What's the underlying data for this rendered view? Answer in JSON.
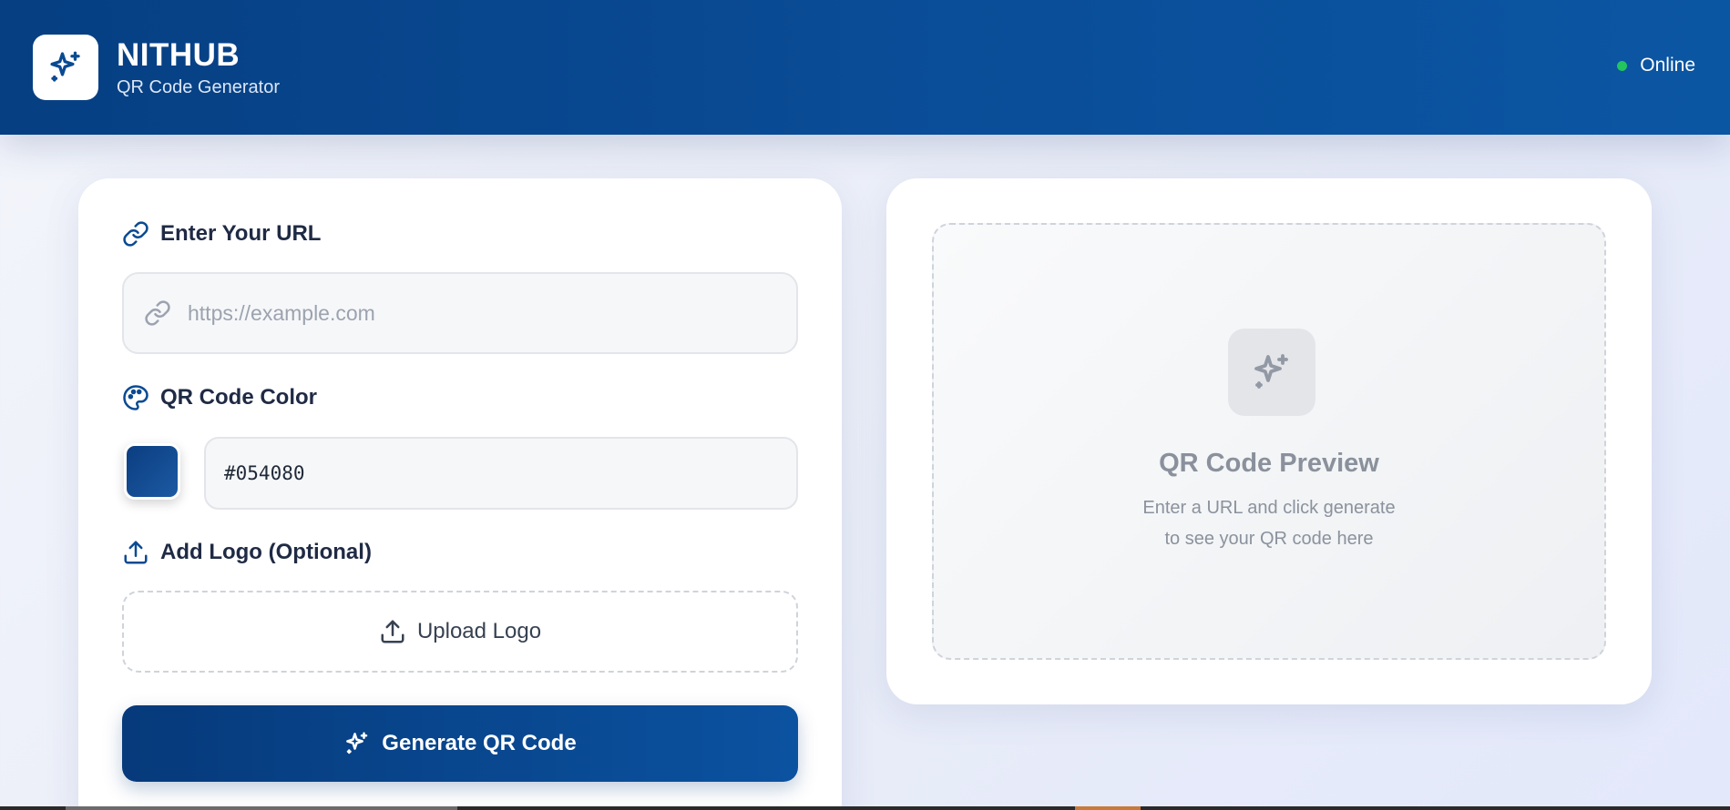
{
  "header": {
    "brand_title": "NITHUB",
    "brand_subtitle": "QR Code Generator",
    "status_text": "Online",
    "status_color": "#22c55e",
    "logo_icon": "sparkles-icon"
  },
  "form": {
    "url_label": "Enter Your URL",
    "url_placeholder": "https://example.com",
    "url_value": "",
    "color_label": "QR Code Color",
    "color_value": "#054080",
    "logo_label": "Add Logo (Optional)",
    "upload_label": "Upload Logo",
    "generate_label": "Generate QR Code"
  },
  "preview": {
    "title": "QR Code Preview",
    "desc_line1": "Enter a URL and click generate",
    "desc_line2": "to see your QR code here"
  },
  "colors": {
    "primary": "#054080",
    "header_start": "#063f82",
    "header_end": "#0b56a3"
  }
}
